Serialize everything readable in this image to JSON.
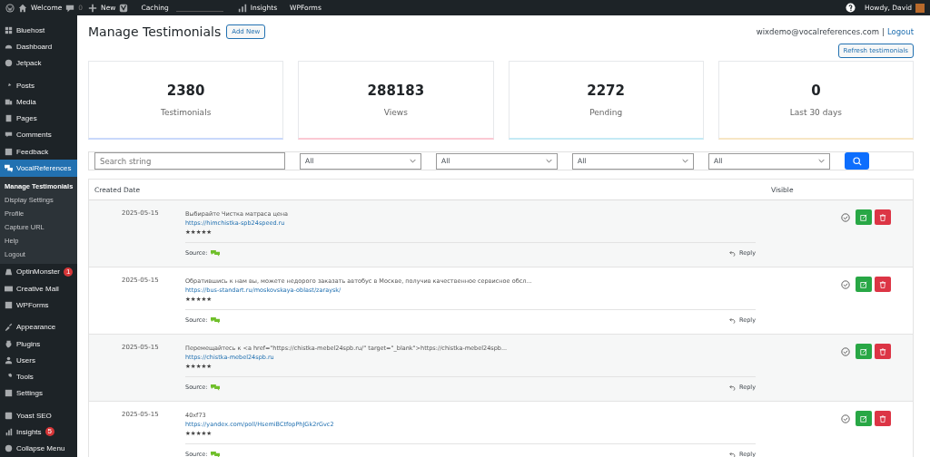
{
  "admin_bar": {
    "site": "Welcome",
    "comments": "0",
    "new": "New",
    "caching": "Caching",
    "insights": "Insights",
    "wpforms": "WPForms",
    "greeting": "Howdy, David"
  },
  "sidebar": {
    "groups": [
      [
        {
          "label": "Bluehost",
          "selected": false
        },
        {
          "label": "Dashboard",
          "selected": false
        },
        {
          "label": "Jetpack",
          "selected": false
        }
      ],
      [
        {
          "label": "Posts",
          "selected": false
        },
        {
          "label": "Media",
          "selected": false
        },
        {
          "label": "Pages",
          "selected": false
        },
        {
          "label": "Comments",
          "selected": false
        },
        {
          "label": "Feedback",
          "selected": false
        },
        {
          "label": "VocalReferences",
          "selected": true,
          "children": [
            {
              "label": "Manage Testimonials",
              "selected": true
            },
            {
              "label": "Display Settings",
              "selected": false
            },
            {
              "label": "Profile",
              "selected": false
            },
            {
              "label": "Capture URL",
              "selected": false
            },
            {
              "label": "Help",
              "selected": false
            },
            {
              "label": "Logout",
              "selected": false
            }
          ]
        },
        {
          "label": "OptinMonster",
          "selected": false,
          "badge": "1"
        },
        {
          "label": "Creative Mail",
          "selected": false
        },
        {
          "label": "WPForms",
          "selected": false
        }
      ],
      [
        {
          "label": "Appearance",
          "selected": false
        },
        {
          "label": "Plugins",
          "selected": false
        },
        {
          "label": "Users",
          "selected": false
        },
        {
          "label": "Tools",
          "selected": false
        },
        {
          "label": "Settings",
          "selected": false
        }
      ],
      [
        {
          "label": "Yoast SEO",
          "selected": false
        },
        {
          "label": "Insights",
          "selected": false,
          "badge": "5"
        },
        {
          "label": "Collapse Menu",
          "selected": false
        }
      ]
    ]
  },
  "page": {
    "title": "Manage Testimonials",
    "add_new": "Add New",
    "account": "wixdemo@vocalreferences.com",
    "separator": "|",
    "logout": "Logout",
    "refresh": "Refresh testimonials"
  },
  "stats": [
    {
      "value": "2380",
      "label": "Testimonials",
      "color": "#c9d8fb"
    },
    {
      "value": "288183",
      "label": "Views",
      "color": "#fbc9d3"
    },
    {
      "value": "2272",
      "label": "Pending",
      "color": "#c4eaf5"
    },
    {
      "value": "0",
      "label": "Last 30 days",
      "color": "#f7e6c4"
    }
  ],
  "filters": {
    "search_placeholder": "Search string",
    "selects": [
      "All",
      "All",
      "All",
      "All"
    ]
  },
  "table": {
    "columns": [
      "Created Date",
      "Visible"
    ],
    "rows": [
      {
        "date": "2025-05-15",
        "text": "Выбирайте Чистка матраса цена",
        "link": "https://himchistka-spb24speed.ru",
        "stars": 5,
        "source": "Source:",
        "reply": "Reply"
      },
      {
        "date": "2025-05-15",
        "text": "Обратившись к нам вы, можете недорого заказать автобус в Москве, получив качественное сервисное обсл...",
        "link": "https://bus-standart.ru/moskovskaya-oblast/zaraysk/",
        "stars": 5,
        "source": "Source:",
        "reply": "Reply"
      },
      {
        "date": "2025-05-15",
        "text": "Перемещайтесь к <a href=\"https://chistka-mebel24spb.ru/\" target=\"_blank\">https://chistka-mebel24spb...",
        "link": "https://chistka-mebel24spb.ru",
        "stars": 5,
        "source": "Source:",
        "reply": "Reply"
      },
      {
        "date": "2025-05-15",
        "text": "40xf73",
        "link": "https://yandex.com/poll/HsemiBCtfopPhJGk2rGvc2",
        "stars": 5,
        "source": "Source:",
        "reply": "Reply"
      }
    ]
  }
}
